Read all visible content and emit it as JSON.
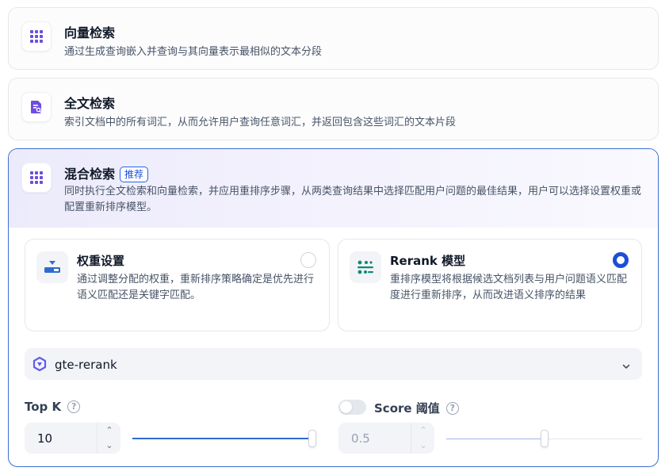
{
  "options": [
    {
      "title": "向量检索",
      "desc": "通过生成查询嵌入并查询与其向量表示最相似的文本分段",
      "icon": "grid-dots-icon"
    },
    {
      "title": "全文检索",
      "desc": "索引文档中的所有词汇，从而允许用户查询任意词汇，并返回包含这些词汇的文本片段",
      "icon": "document-search-icon"
    }
  ],
  "hybrid": {
    "title": "混合检索",
    "badge": "推荐",
    "desc": "同时执行全文检索和向量检索，并应用重排序步骤，从两类查询结果中选择匹配用户问题的最佳结果，用户可以选择设置权重或配置重新排序模型。",
    "icon": "grid-dots-icon"
  },
  "modes": {
    "weight": {
      "title": "权重设置",
      "desc": "通过调整分配的权重，重新排序策略确定是优先进行语义匹配还是关键字匹配。",
      "selected": false,
      "icon": "weight-sliders-icon"
    },
    "rerank": {
      "title": "Rerank 模型",
      "desc": "重排序模型将根据候选文档列表与用户问题语义匹配度进行重新排序，从而改进语义排序的结果",
      "selected": true,
      "icon": "rerank-sort-icon"
    }
  },
  "model_select": {
    "value": "gte-rerank",
    "icon": "qwen-logo-icon"
  },
  "top_k": {
    "label": "Top K",
    "value": "10",
    "slider_fraction": 1.0
  },
  "score": {
    "label": "Score 阈值",
    "value": "0.5",
    "enabled": false,
    "slider_fraction": 0.5
  },
  "colors": {
    "accent": "#1d4ed8",
    "icon_purple": "#6e4de0",
    "icon_teal": "#0f8a7a"
  }
}
